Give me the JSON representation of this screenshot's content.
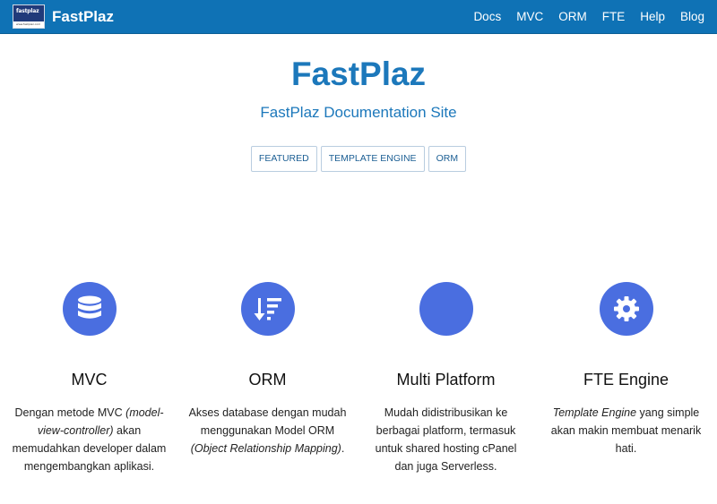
{
  "navbar": {
    "logo_text": "fastplaz",
    "logo_subtext": "www.fastplaz.com",
    "brand": "FastPlaz",
    "links": [
      "Docs",
      "MVC",
      "ORM",
      "FTE",
      "Help",
      "Blog"
    ]
  },
  "hero": {
    "title": "FastPlaz",
    "subtitle": "FastPlaz Documentation Site",
    "tags": [
      "FEATURED",
      "TEMPLATE ENGINE",
      "ORM"
    ]
  },
  "features": [
    {
      "icon": "database-icon",
      "title": "MVC",
      "desc_1": "Dengan metode MVC ",
      "desc_em": "(model-view-controller)",
      "desc_2": " akan memudahkan developer dalam mengembangkan aplikasi."
    },
    {
      "icon": "sort-amount-icon",
      "title": "ORM",
      "desc_1": "Akses database dengan mudah menggunakan Model ORM ",
      "desc_em": "(Object Relationship Mapping)",
      "desc_2": "."
    },
    {
      "icon": "platform-icon",
      "title": "Multi Platform",
      "desc_1": "Mudah didistribusikan ke berbagai platform, termasuk untuk shared hosting cPanel dan juga Serverless.",
      "desc_em": "",
      "desc_2": ""
    },
    {
      "icon": "gear-icon",
      "title": "FTE Engine",
      "desc_1": "",
      "desc_em": "Template Engine",
      "desc_2": " yang simple akan makin membuat menarik hati."
    }
  ],
  "colors": {
    "navbar": "#0f72b5",
    "accent_text": "#1c78bb",
    "icon_circle": "#4a6ee0"
  }
}
